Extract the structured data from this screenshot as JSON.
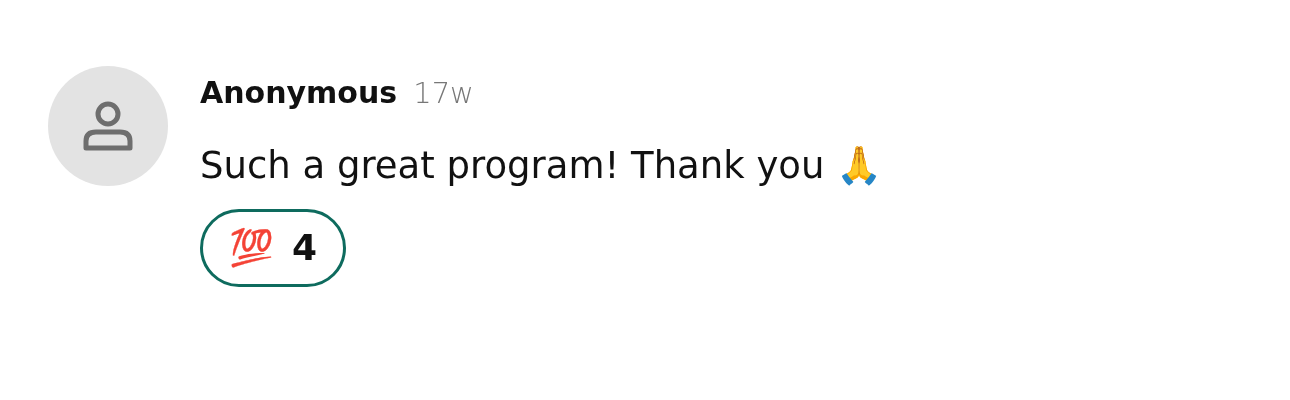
{
  "comment": {
    "author": "Anonymous",
    "time": "17w",
    "text": "Such a great program! Thank you 🙏",
    "reactions": [
      {
        "emoji": "💯",
        "count": "4",
        "selected": true
      }
    ]
  }
}
